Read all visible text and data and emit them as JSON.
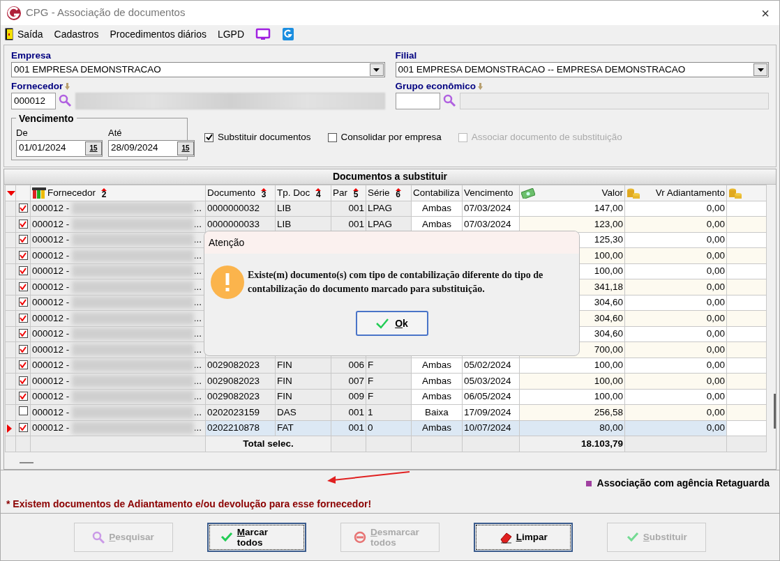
{
  "window": {
    "title": "CPG - Associação de documentos",
    "close": "×"
  },
  "menu": [
    {
      "kind": "exit",
      "label": "Saída"
    },
    {
      "kind": "text",
      "label": "Cadastros"
    },
    {
      "kind": "text",
      "label": "Procedimentos diários"
    },
    {
      "kind": "text",
      "label": "LGPD"
    },
    {
      "kind": "monitor"
    },
    {
      "kind": "logo"
    }
  ],
  "empresa": {
    "label": "Empresa",
    "value": "001 EMPRESA DEMONSTRACAO"
  },
  "filial": {
    "label": "Filial",
    "value": "001 EMPRESA DEMONSTRACAO -- EMPRESA DEMONSTRACAO"
  },
  "fornecedor": {
    "label": "Fornecedor",
    "code": "000012"
  },
  "grupo": {
    "label": "Grupo econômico"
  },
  "vencimento": {
    "title": "Vencimento",
    "from_label": "De",
    "from": "01/01/2024",
    "to_label": "Até",
    "to": "28/09/2024",
    "from_calendar": "15",
    "to_calendar": "15"
  },
  "options": [
    {
      "label": "Substituir documentos",
      "checked": true,
      "disabled": false
    },
    {
      "label": "Consolidar por empresa",
      "checked": false,
      "disabled": false
    },
    {
      "label": "Associar documento de substituição",
      "checked": false,
      "disabled": true
    }
  ],
  "grid": {
    "title": "Documentos a substituir",
    "columns": [
      {
        "label": "Fornecedor",
        "sort": "2"
      },
      {
        "label": "Documento",
        "sort": "3"
      },
      {
        "label": "Tp. Doc",
        "sort": "4"
      },
      {
        "label": "Par",
        "sort": "5"
      },
      {
        "label": "Série",
        "sort": "6"
      },
      {
        "label": "Contabiliza"
      },
      {
        "label": "Vencimento"
      },
      {
        "label": "Valor"
      },
      {
        "label": "Vr Adiantamento"
      }
    ],
    "rows": [
      {
        "checked": true,
        "selected": false,
        "supplier": "000012 -",
        "more": "...",
        "documento": "0000000032",
        "tp_doc": "LIB",
        "par": "001",
        "serie": "LPAG",
        "contabiliza": "Ambas",
        "vencimento": "07/03/2024",
        "valor": "147,00",
        "adiantamento": "0,00"
      },
      {
        "checked": true,
        "selected": false,
        "supplier": "000012 -",
        "more": "...",
        "documento": "0000000033",
        "tp_doc": "LIB",
        "par": "001",
        "serie": "LPAG",
        "contabiliza": "Ambas",
        "vencimento": "07/03/2024",
        "valor": "123,00",
        "adiantamento": "0,00"
      },
      {
        "checked": true,
        "selected": false,
        "supplier": "000012 -",
        "more": "...",
        "valor": "125,30",
        "adiantamento": "0,00"
      },
      {
        "checked": true,
        "selected": false,
        "supplier": "000012 -",
        "more": "...",
        "valor": "100,00",
        "adiantamento": "0,00"
      },
      {
        "checked": true,
        "selected": false,
        "supplier": "000012 -",
        "more": "...",
        "valor": "100,00",
        "adiantamento": "0,00"
      },
      {
        "checked": true,
        "selected": false,
        "supplier": "000012 -",
        "more": "...",
        "valor": "341,18",
        "adiantamento": "0,00"
      },
      {
        "checked": true,
        "selected": false,
        "supplier": "000012 -",
        "more": "...",
        "valor": "304,60",
        "adiantamento": "0,00"
      },
      {
        "checked": true,
        "selected": false,
        "supplier": "000012 -",
        "more": "...",
        "valor": "304,60",
        "adiantamento": "0,00"
      },
      {
        "checked": true,
        "selected": false,
        "supplier": "000012 -",
        "more": "...",
        "valor": "304,60",
        "adiantamento": "0,00"
      },
      {
        "checked": true,
        "selected": false,
        "supplier": "000012 -",
        "more": "...",
        "valor": "700,00",
        "adiantamento": "0,00"
      },
      {
        "checked": true,
        "selected": false,
        "supplier": "000012 -",
        "more": "...",
        "documento": "0029082023",
        "tp_doc": "FIN",
        "par": "006",
        "serie": "F",
        "contabiliza": "Ambas",
        "vencimento": "05/02/2024",
        "valor": "100,00",
        "adiantamento": "0,00"
      },
      {
        "checked": true,
        "selected": false,
        "supplier": "000012 -",
        "more": "...",
        "documento": "0029082023",
        "tp_doc": "FIN",
        "par": "007",
        "serie": "F",
        "contabiliza": "Ambas",
        "vencimento": "05/03/2024",
        "valor": "100,00",
        "adiantamento": "0,00"
      },
      {
        "checked": true,
        "selected": false,
        "supplier": "000012 -",
        "more": "...",
        "documento": "0029082023",
        "tp_doc": "FIN",
        "par": "009",
        "serie": "F",
        "contabiliza": "Ambas",
        "vencimento": "06/05/2024",
        "valor": "100,00",
        "adiantamento": "0,00"
      },
      {
        "checked": false,
        "selected": false,
        "supplier": "000012 -",
        "more": "...",
        "documento": "0202023159",
        "tp_doc": "DAS",
        "par": "001",
        "serie": "1",
        "contabiliza": "Baixa",
        "vencimento": "17/09/2024",
        "valor": "256,58",
        "adiantamento": "0,00"
      },
      {
        "checked": true,
        "selected": true,
        "supplier": "000012 -",
        "more": "...",
        "documento": "0202210878",
        "tp_doc": "FAT",
        "par": "001",
        "serie": "0",
        "contabiliza": "Ambas",
        "vencimento": "10/07/2024",
        "valor": "80,00",
        "adiantamento": "0,00"
      }
    ],
    "total_label": "Total selec.",
    "total": "18.103,79"
  },
  "legend": {
    "label": "Associação com agência Retaguarda",
    "color": "#a040a0"
  },
  "notice": "* Existem documentos de Adiantamento e/ou devolução para esse fornecedor!",
  "buttons": [
    {
      "kind": "search",
      "accel": "P",
      "rest": "esquisar",
      "disabled": true,
      "focused": false
    },
    {
      "kind": "check",
      "accel": "M",
      "rest": "arcar todos",
      "disabled": false,
      "focused": true
    },
    {
      "kind": "forbid",
      "accel": "D",
      "rest": "esmarcar todos",
      "disabled": true,
      "focused": false
    },
    {
      "kind": "eraser",
      "accel": "L",
      "rest": "impar",
      "disabled": false,
      "focused": true
    },
    {
      "kind": "check",
      "accel": "S",
      "rest": "ubstituir",
      "disabled": true,
      "focused": false
    }
  ],
  "dialog": {
    "title": "Atenção",
    "message": "Existe(m) documento(s) com tipo de contabilização diferente do tipo de contabilização do documento marcado para substituição.",
    "ok_accel": "O",
    "ok_rest": "k"
  }
}
